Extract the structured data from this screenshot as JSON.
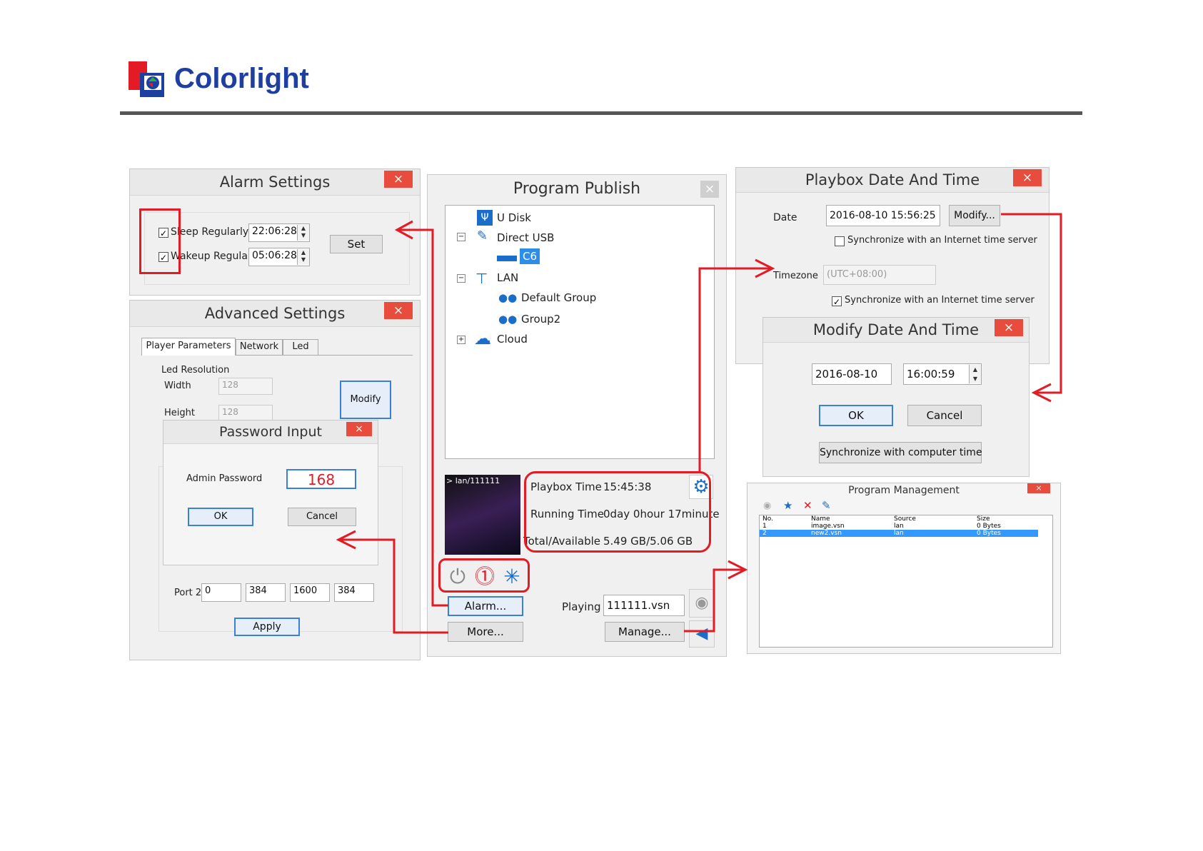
{
  "brand": {
    "name": "Colorlight",
    "color": "#1e3fa0",
    "accent": "#e21b24"
  },
  "alarm_settings": {
    "title": "Alarm Settings",
    "close": "×",
    "sleep_label": "Sleep Regularly",
    "sleep_checked": true,
    "sleep_time": "22:06:28",
    "wakeup_label": "Wakeup Regularly",
    "wakeup_checked": true,
    "wakeup_time": "05:06:28",
    "set_button": "Set"
  },
  "advanced_settings": {
    "title": "Advanced Settings",
    "close": "×",
    "tabs": [
      "Player Parameters",
      "Network",
      "Led"
    ],
    "led_resolution_label": "Led Resolution",
    "width_label": "Width",
    "width_value": "128",
    "height_label": "Height",
    "height_value": "128",
    "modify_button": "Modify",
    "port2_label": "Port 2",
    "port2_values": [
      "0",
      "384",
      "1600",
      "384"
    ],
    "apply_button": "Apply"
  },
  "password_input": {
    "title": "Password Input",
    "close": "×",
    "label": "Admin Password",
    "value": "168",
    "ok_button": "OK",
    "cancel_button": "Cancel"
  },
  "program_publish": {
    "title": "Program Publish",
    "close": "×",
    "tree": {
      "u_disk": "U Disk",
      "direct_usb": "Direct USB",
      "c6": "C6",
      "lan": "LAN",
      "default_group": "Default Group",
      "group2": "Group2",
      "cloud": "Cloud"
    },
    "thumb_label": "> lan/111111",
    "playbox_time_label": "Playbox Time",
    "playbox_time_value": "15:45:38",
    "running_time_label": "Running Time",
    "running_time_value": "0day 0hour 17minute",
    "total_label": "Total/Available",
    "total_value": "5.49 GB/5.06 GB",
    "alarm_button": "Alarm...",
    "more_button": "More...",
    "playing_label": "Playing",
    "playing_value": "111111.vsn",
    "manage_button": "Manage..."
  },
  "playbox_date": {
    "title": "Playbox Date And Time",
    "close": "×",
    "date_label": "Date",
    "date_value": "2016-08-10 15:56:25",
    "modify_button": "Modify...",
    "sync1_label": "Synchronize with an Internet time server",
    "sync1_checked": false,
    "timezone_label": "Timezone",
    "timezone_value": "(UTC+08:00)",
    "sync2_label": "Synchronize with an Internet time server",
    "sync2_checked": true
  },
  "modify_date": {
    "title": "Modify Date And Time",
    "close": "×",
    "date_value": "2016-08-10",
    "time_value": "16:00:59",
    "ok_button": "OK",
    "cancel_button": "Cancel",
    "sync_button": "Synchronize with computer time"
  },
  "program_management": {
    "title": "Program Management",
    "close": "×",
    "columns": [
      "No.",
      "Name",
      "Source",
      "Size"
    ],
    "rows": [
      [
        "1",
        "image.vsn",
        "lan",
        "0 Bytes"
      ],
      [
        "2",
        "new2.vsn",
        "lan",
        "0 Bytes"
      ]
    ]
  }
}
